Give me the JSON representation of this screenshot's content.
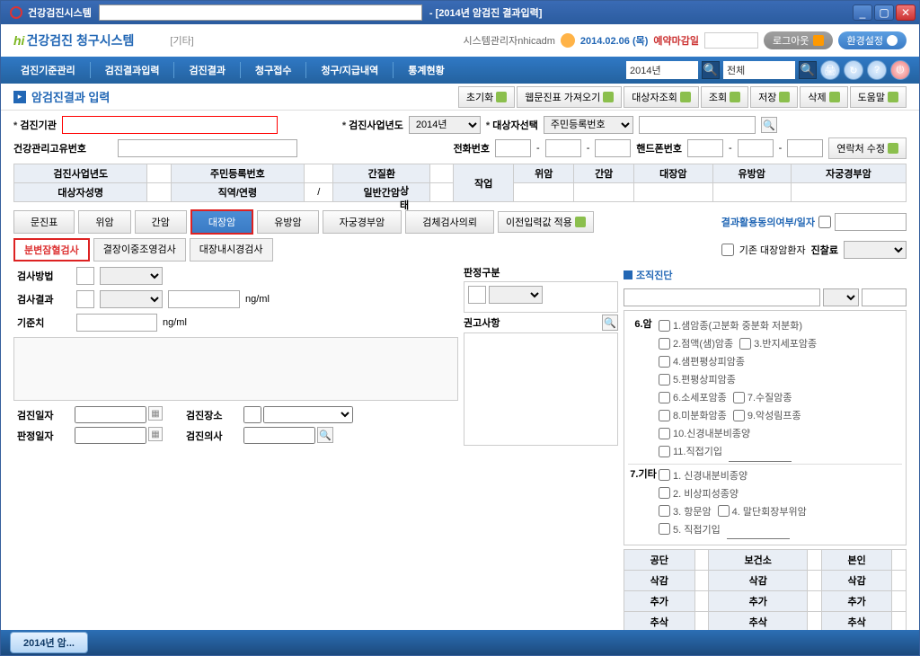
{
  "titlebar": {
    "app": "건강검진시스템",
    "route": "- [2014년 암검진 결과입력]"
  },
  "logorow": {
    "logo_system": " 건강검진",
    "logo_brand": "청구시스템",
    "logo_sub": "[기타]",
    "admin_label": "시스템관리자",
    "admin_user": "nhicadm",
    "date": "2014.02.06 (목)",
    "deadline_label": "예약마감일",
    "logout": "로그아웃",
    "settings": "환경설정"
  },
  "menubar": {
    "items": [
      "검진기준관리",
      "검진결과입력",
      "검진결과",
      "청구접수",
      "청구/지급내역",
      "통계현황"
    ],
    "year": "2014년",
    "filter": "전체"
  },
  "page_title": {
    "title": "암검진결과 입력",
    "actions": [
      "초기화",
      "웹문진표 가져오기",
      "대상자조회",
      "조회",
      "저장",
      "삭제",
      "도움말"
    ]
  },
  "info_band": {
    "org_label": "검진기관",
    "year_label": "검진사업년도",
    "year_value": "2014년",
    "pick_label": "대상자선택",
    "pick_value": "주민등록번호",
    "row2": {
      "health_code": "건강관리고유번호",
      "phone": "전화번호",
      "cell": "핸드폰번호",
      "contact_edit": "연락처 수정"
    },
    "table": {
      "r1": [
        "검진사업년도",
        "",
        "주민등록번호",
        "",
        "간질환",
        "",
        "작업",
        "위암",
        "간암",
        "대장암",
        "유방암",
        "자궁경부암"
      ],
      "r2": [
        "대상자성명",
        "",
        "직역/연령",
        "/",
        "일반간암",
        "",
        "상태",
        "",
        "",
        "",
        "",
        ""
      ]
    }
  },
  "tabs": {
    "items": [
      "문진표",
      "위암",
      "간암",
      "대장암",
      "유방암",
      "자궁경부암",
      "검체검사의뢰"
    ],
    "apply_btn": "이전입력값 적용",
    "consent_label": "결과활용동의여부/일자"
  },
  "subtabs": {
    "items": [
      "분변잠혈검사",
      "결장이중조영검사",
      "대장내시경검사"
    ],
    "existing_chk": "기존 대장암환자",
    "fee_label": "진찰료"
  },
  "left_form": {
    "method": "검사방법",
    "result": "검사결과",
    "unit": "ng/ml",
    "ref": "기준치",
    "exam_date": "검진일자",
    "exam_place": "검진장소",
    "judge_date": "판정일자",
    "exam_doc": "검진의사"
  },
  "mid": {
    "class_label": "판정구분",
    "recommend_label": "권고사항"
  },
  "right": {
    "diag_title": "조직진단",
    "group6": {
      "num": "6.암",
      "items": [
        "1.샘암종(고분화 중분화 저분화)",
        "2.점액(샘)암종",
        "3.반지세포암종",
        "4.샘편평상피암종",
        "5.편평상피암종",
        "6.소세포암종",
        "7.수질암종",
        "8.미분화암종",
        "9.악성림프종",
        "10.신경내분비종양",
        "11.직접기입"
      ]
    },
    "group7": {
      "num": "7.기타",
      "items": [
        "1. 신경내분비종양",
        "2. 비상피성종양",
        "3. 항문암",
        "4. 말단회장부위암",
        "5. 직접기입"
      ]
    },
    "adj_headers": [
      "공단",
      "보건소",
      "본인"
    ],
    "adj_rows": [
      "삭감",
      "추가",
      "추삭"
    ]
  },
  "taskbar": {
    "item": "2014년 암..."
  }
}
